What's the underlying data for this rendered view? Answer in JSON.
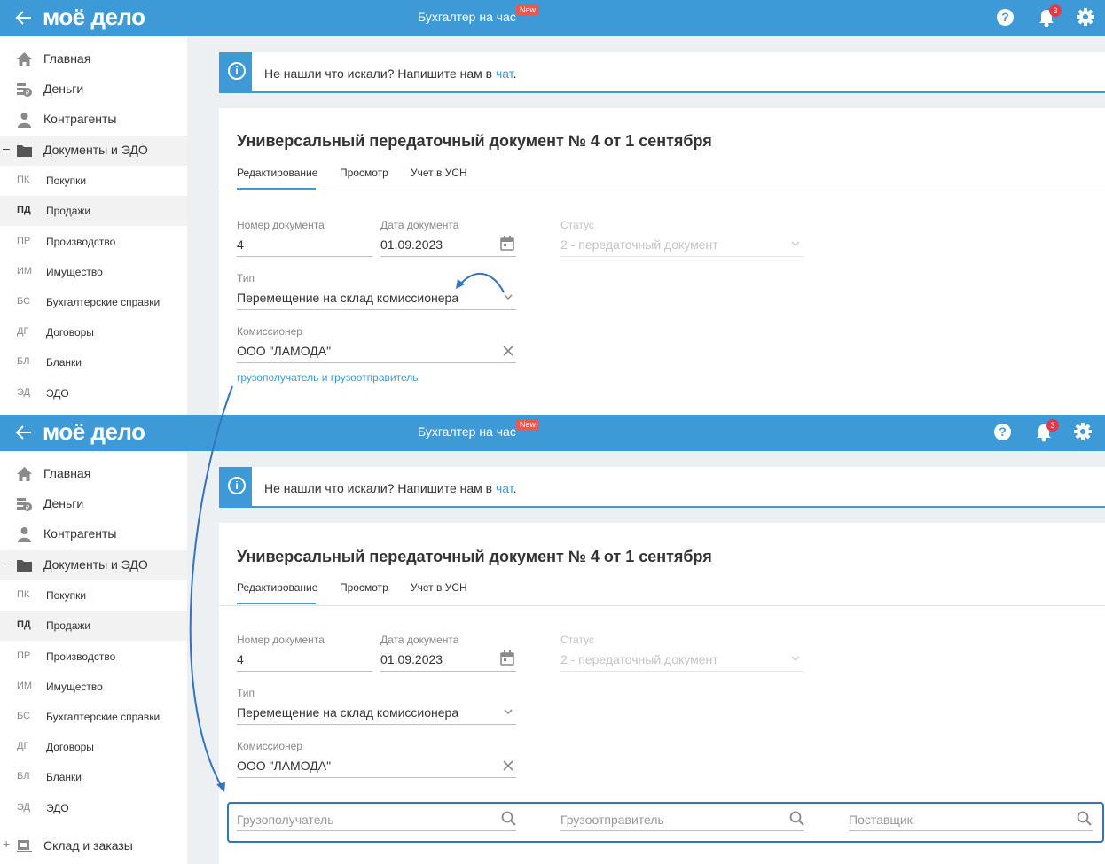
{
  "header": {
    "logo": "моё дело",
    "center_label": "Бухгалтер на час",
    "new_badge": "New",
    "help_icon": "?",
    "notifications_count": "3",
    "brand_color": "#3e9ad6"
  },
  "sidebar": {
    "items": [
      {
        "label": "Главная",
        "icon": "home-icon"
      },
      {
        "label": "Деньги",
        "icon": "money-icon"
      },
      {
        "label": "Контрагенты",
        "icon": "contractors-icon"
      },
      {
        "label": "Документы и ЭДО",
        "icon": "folder-icon",
        "toggle": "–"
      }
    ],
    "subitems": [
      {
        "code": "ПК",
        "label": "Покупки"
      },
      {
        "code": "ПД",
        "label": "Продажи"
      },
      {
        "code": "ПР",
        "label": "Производство"
      },
      {
        "code": "ИМ",
        "label": "Имущество"
      },
      {
        "code": "БС",
        "label": "Бухгалтерские справки"
      },
      {
        "code": "ДГ",
        "label": "Договоры"
      },
      {
        "code": "БЛ",
        "label": "Бланки"
      },
      {
        "code": "ЭД",
        "label": "ЭДО"
      }
    ],
    "extra_item": {
      "label": "Склад и заказы",
      "toggle": "+",
      "icon": "warehouse-icon"
    }
  },
  "info": {
    "text": "Не нашли что искали? Напишите нам в ",
    "link": "чат",
    "after": "."
  },
  "document": {
    "title": "Универсальный передаточный документ № 4 от 1 сентября",
    "tabs": [
      "Редактирование",
      "Просмотр",
      "Учет в УСН"
    ],
    "fields": {
      "number_label": "Номер документа",
      "number_value": "4",
      "date_label": "Дата документа",
      "date_value": "01.09.2023",
      "status_label": "Статус",
      "status_value": "2 - передаточный документ",
      "type_label": "Тип",
      "type_value": "Перемещение на склад комиссионера",
      "commissioner_label": "Комиссионер",
      "commissioner_value": "ООО \"ЛАМОДА\""
    },
    "consignee_link": "грузополучатель и грузоотправитель",
    "extra_fields": {
      "consignee_placeholder": "Грузополучатель",
      "shipper_placeholder": "Грузоотправитель",
      "supplier_placeholder": "Поставщик"
    }
  },
  "annotation_color": "#3572c0"
}
